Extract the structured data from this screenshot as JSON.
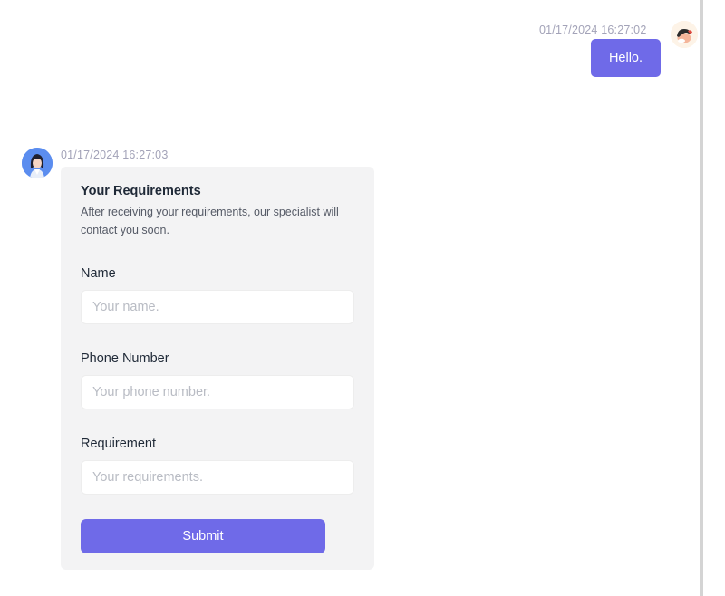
{
  "conversation": {
    "user_message": {
      "timestamp": "01/17/2024 16:27:02",
      "text": "Hello.",
      "avatar": "user-avatar-icon"
    },
    "bot_message": {
      "timestamp": "01/17/2024 16:27:03",
      "avatar": "agent-avatar-icon"
    }
  },
  "form": {
    "title": "Your Requirements",
    "description": "After receiving your requirements, our specialist will contact you soon.",
    "fields": {
      "name": {
        "label": "Name",
        "value": "",
        "placeholder": "Your name."
      },
      "phone": {
        "label": "Phone Number",
        "value": "",
        "placeholder": "Your phone number."
      },
      "requirement": {
        "label": "Requirement",
        "value": "",
        "placeholder": "Your requirements."
      }
    },
    "submit_label": "Submit"
  },
  "colors": {
    "accent": "#6f6ae8",
    "card_background": "#f3f3f4",
    "timestamp": "#a3a3b8",
    "bot_avatar": "#5b8def"
  }
}
